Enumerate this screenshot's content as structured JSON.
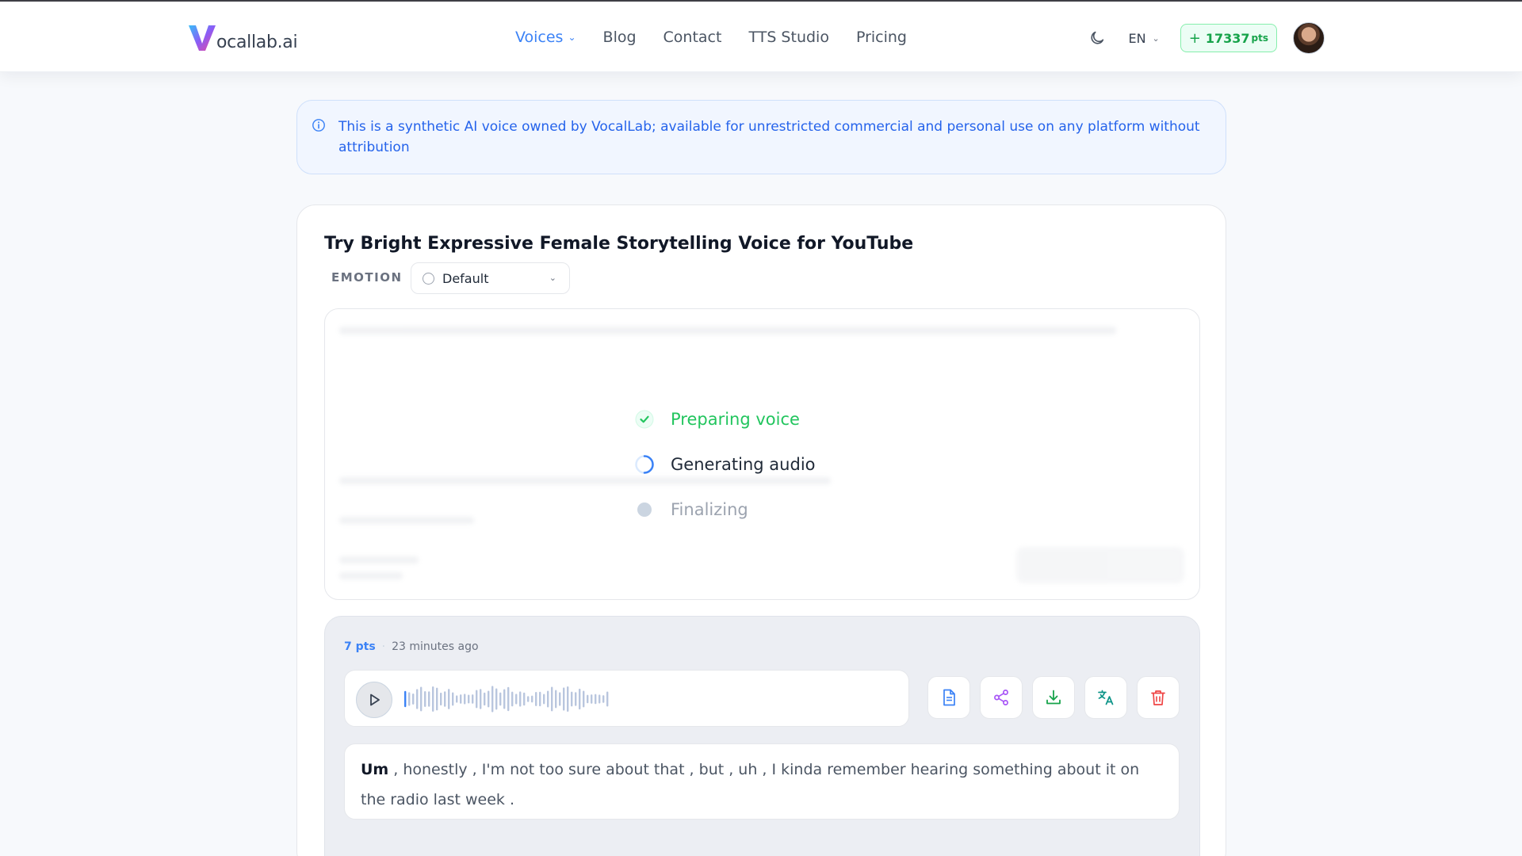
{
  "nav": {
    "logo_text": "ocallab.ai",
    "links": [
      {
        "label": "Voices"
      },
      {
        "label": "Blog"
      },
      {
        "label": "Contact"
      },
      {
        "label": "TTS Studio"
      },
      {
        "label": "Pricing"
      }
    ],
    "language": "EN",
    "points_plus": "+",
    "points_value": "17337",
    "points_unit": "pts"
  },
  "notice": {
    "text": "This is a synthetic AI voice owned by VocalLab; available for unrestricted commercial and personal use on any platform without attribution"
  },
  "tryvoice": {
    "title": "Try Bright Expressive Female Storytelling Voice for YouTube",
    "emotion_label": "EMOTION",
    "emotion_value": "Default"
  },
  "progress": {
    "steps": [
      {
        "label": "Preparing voice",
        "state": "done"
      },
      {
        "label": "Generating audio",
        "state": "active"
      },
      {
        "label": "Finalizing",
        "state": "pending"
      }
    ]
  },
  "result": {
    "cost": "7 pts",
    "separator": "·",
    "time": "23 minutes ago",
    "transcript_first": "Um",
    "transcript_rest": " , honestly , I'm not too sure about that , but , uh , I kinda remember hearing something about it on the radio last week ."
  },
  "colors": {
    "accent": "#3b82f6",
    "success": "#22c55e",
    "danger": "#ef4444",
    "purple": "#a855f7",
    "teal": "#0d9488"
  }
}
